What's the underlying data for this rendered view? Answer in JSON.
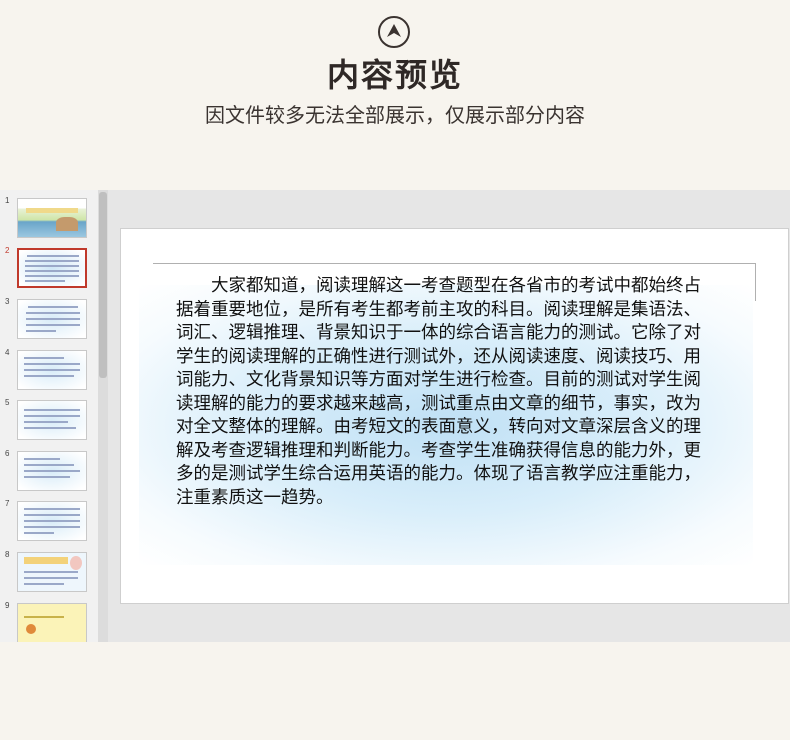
{
  "header": {
    "title": "内容预览",
    "subtitle": "因文件较多无法全部展示，仅展示部分内容"
  },
  "viewer": {
    "active_slide": 2,
    "thumbnails": [
      {
        "number": "1",
        "style": "title-banner"
      },
      {
        "number": "2",
        "style": "text",
        "active": true
      },
      {
        "number": "3",
        "style": "text"
      },
      {
        "number": "4",
        "style": "text"
      },
      {
        "number": "5",
        "style": "text"
      },
      {
        "number": "6",
        "style": "text"
      },
      {
        "number": "7",
        "style": "text"
      },
      {
        "number": "8",
        "style": "banner-cartoon"
      },
      {
        "number": "9",
        "style": "yellow"
      }
    ],
    "slide": {
      "body": "大家都知道，阅读理解这一考查题型在各省市的考试中都始终占据着重要地位，是所有考生都考前主攻的科目。阅读理解是集语法、词汇、逻辑推理、背景知识于一体的综合语言能力的测试。它除了对学生的阅读理解的正确性进行测试外，还从阅读速度、阅读技巧、用词能力、文化背景知识等方面对学生进行检查。目前的测试对学生阅读理解的能力的要求越来越高，测试重点由文章的细节，事实，改为对全文整体的理解。由考短文的表面意义，转向对文章深层含义的理解及考查逻辑推理和判断能力。考查学生准确获得信息的能力外，更多的是测试学生综合运用英语的能力。体现了语言教学应注重能力，注重素质这一趋势。"
    }
  },
  "colors": {
    "page_background": "#f7f4ee",
    "active_thumbnail": "#c0392b",
    "slide_glow": "#bfe0f5"
  },
  "icons": {
    "logo": "arrow-up-circle-icon"
  }
}
